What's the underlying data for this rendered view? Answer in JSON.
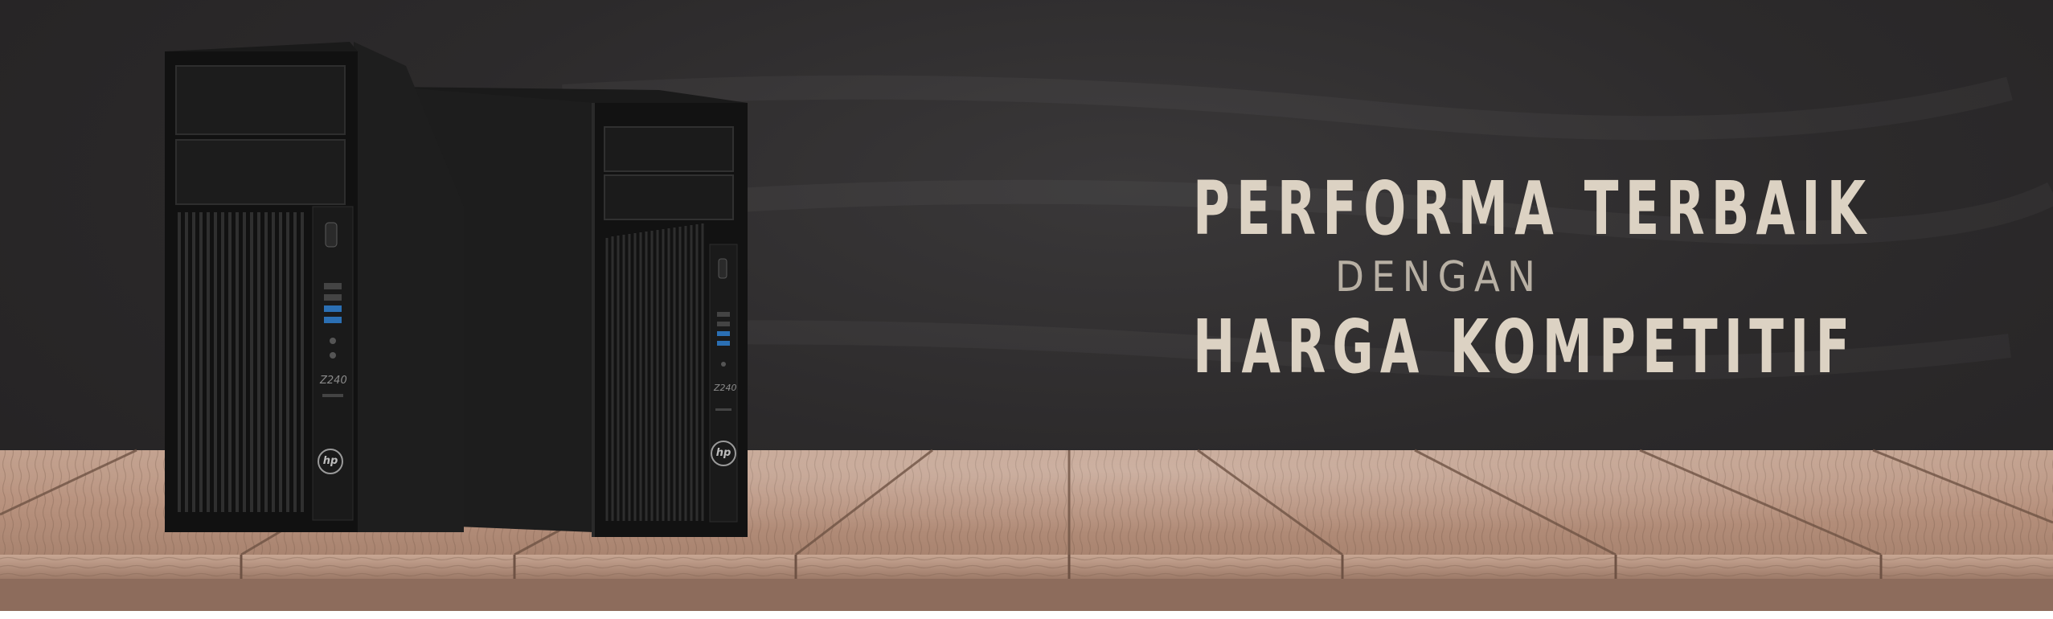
{
  "headline": {
    "line1": "PERFORMA TERBAIK",
    "line2": "DENGAN",
    "line3": "HARGA KOMPETITIF"
  },
  "products": {
    "left": {
      "model_label": "Z240",
      "brand": "hp"
    },
    "right": {
      "model_label": "Z240",
      "brand": "hp"
    }
  },
  "colors": {
    "background": "#2c2a2b",
    "headline_text": "#dcd2c3",
    "subtitle_text": "#b8b0a4",
    "wood_light": "#c9a892",
    "wood_dark": "#8e6f5e"
  }
}
